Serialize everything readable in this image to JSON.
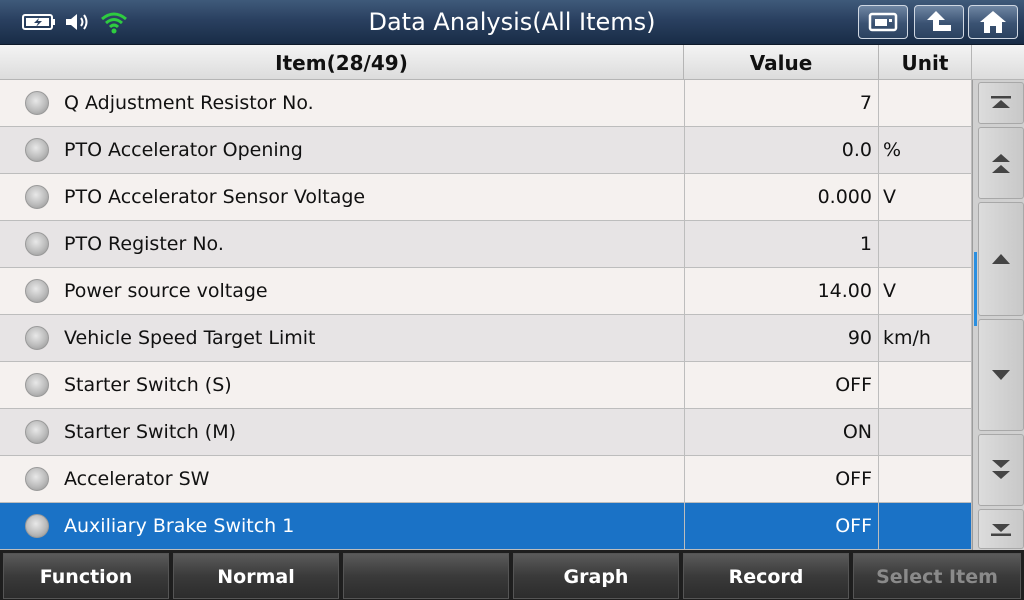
{
  "header": {
    "title": "Data Analysis(All Items)",
    "buttons": {
      "left": "print-icon",
      "middle": "back-arrow-icon",
      "right": "home-icon"
    }
  },
  "status": {
    "battery": "battery-charging-icon",
    "volume": "speaker-icon",
    "wifi": "wifi-icon",
    "wifi_color": "#2ecc40"
  },
  "table": {
    "columns": {
      "item": "Item(28/49)",
      "value": "Value",
      "unit": "Unit"
    },
    "rows": [
      {
        "name": "Q Adjustment Resistor No.",
        "value": "7",
        "unit": ""
      },
      {
        "name": "PTO Accelerator Opening",
        "value": "0.0",
        "unit": "%"
      },
      {
        "name": "PTO Accelerator Sensor Voltage",
        "value": "0.000",
        "unit": "V"
      },
      {
        "name": "PTO Register No.",
        "value": "1",
        "unit": ""
      },
      {
        "name": "Power source voltage",
        "value": "14.00",
        "unit": "V"
      },
      {
        "name": "Vehicle Speed Target Limit",
        "value": "90",
        "unit": "km/h"
      },
      {
        "name": "Starter Switch (S)",
        "value": "OFF",
        "unit": ""
      },
      {
        "name": "Starter Switch (M)",
        "value": "ON",
        "unit": ""
      },
      {
        "name": "Accelerator SW",
        "value": "OFF",
        "unit": ""
      },
      {
        "name": "Auxiliary Brake Switch 1",
        "value": "OFF",
        "unit": ""
      }
    ],
    "selected_index": 9,
    "selected_color": "#1a72c6"
  },
  "scrollbar": {
    "buttons": [
      "scroll-top-icon",
      "page-up-icon",
      "line-up-icon",
      "line-down-icon",
      "page-down-icon",
      "scroll-bottom-icon"
    ],
    "accent": "#2a8fe0"
  },
  "toolbar": {
    "function_label": "Function",
    "normal_label": "Normal",
    "empty_label": "",
    "graph_label": "Graph",
    "record_label": "Record",
    "select_item_label": "Select Item"
  }
}
